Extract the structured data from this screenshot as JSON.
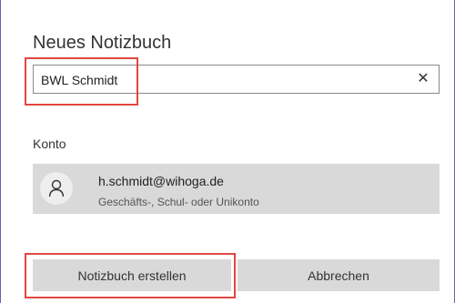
{
  "dialog": {
    "title": "Neues Notizbuch",
    "name_input": {
      "value": "BWL Schmidt"
    },
    "account_section_label": "Konto",
    "account": {
      "email": "h.schmidt@wihoga.de",
      "type": "Geschäfts-, Schul- oder Unikonto"
    },
    "buttons": {
      "create_label": "Notizbuch erstellen",
      "cancel_label": "Abbrechen"
    }
  },
  "icons": {
    "clear": "close-icon",
    "avatar": "person-icon"
  },
  "colors": {
    "highlight": "#e0473f",
    "button_bg": "#d9d9d9",
    "accent_border": "#7a58b8"
  }
}
